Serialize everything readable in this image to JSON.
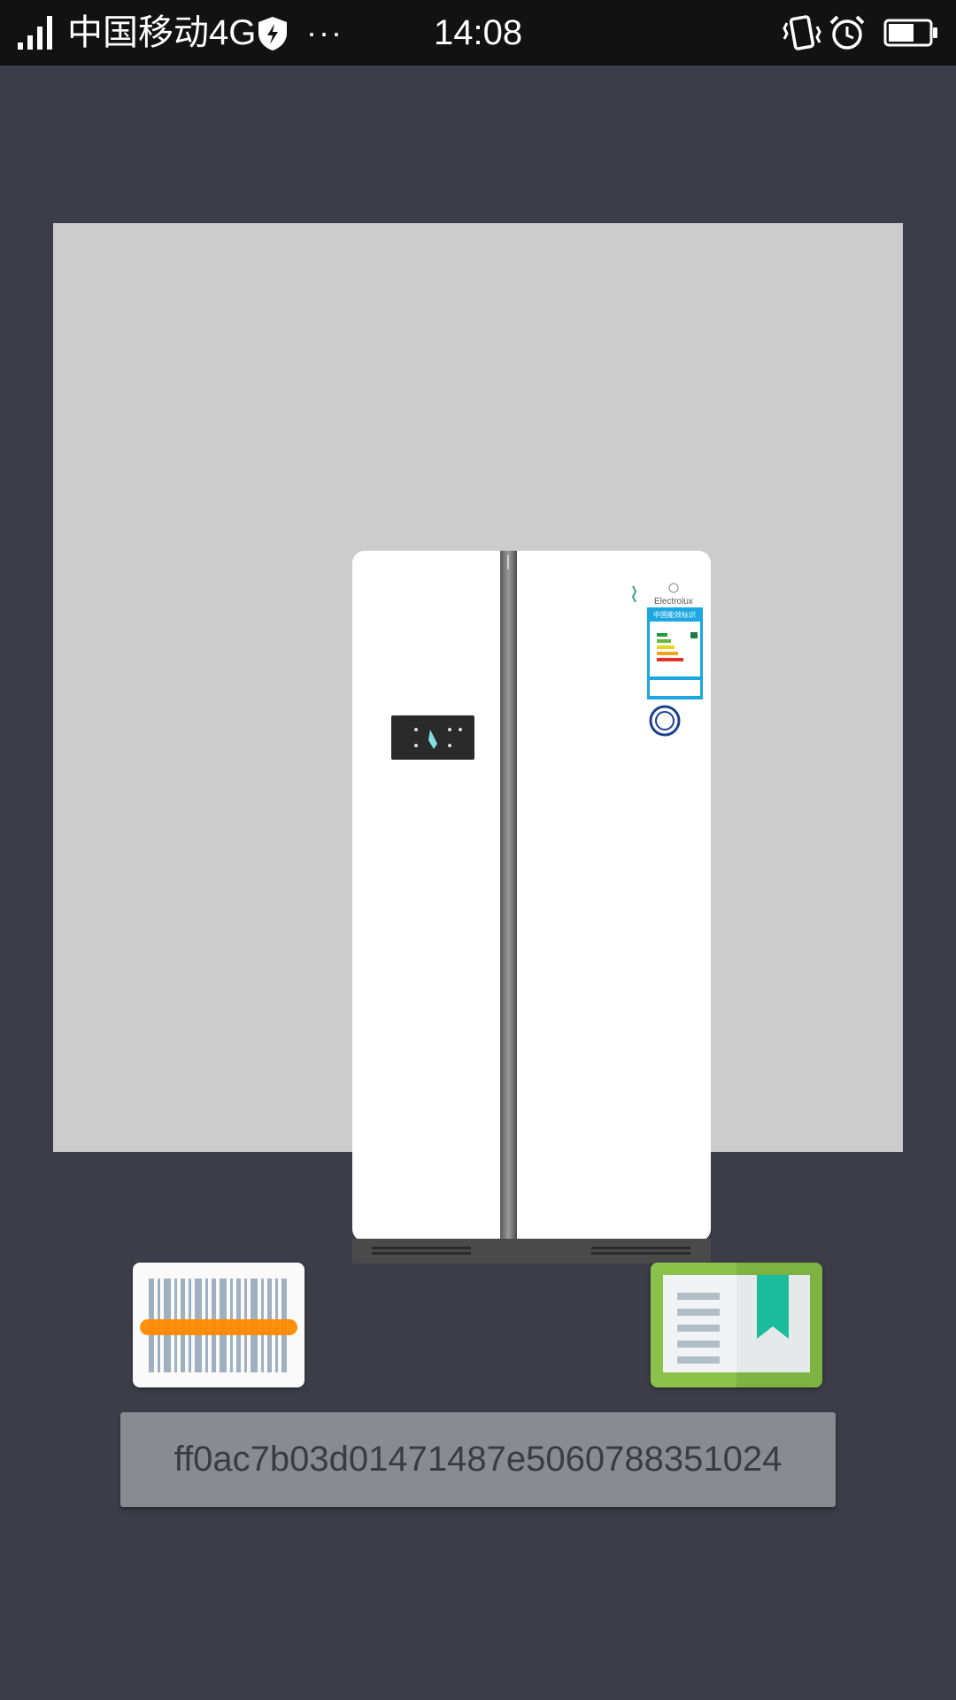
{
  "status_bar": {
    "carrier": "中国移动4G",
    "more": "···",
    "time": "14:08",
    "icons": [
      "signal-icon",
      "shield-icon",
      "vibrate-icon",
      "alarm-icon",
      "battery-icon"
    ],
    "background": "#121212"
  },
  "product": {
    "image": "refrigerator-image",
    "brand": "Electrolux",
    "energy_label_title": "中国能效标识",
    "panel_background": "#cccccc"
  },
  "actions": {
    "scan_icon": "barcode-scan-icon",
    "catalog_icon": "book-bookmark-icon",
    "scan_accent": "#ff8a00",
    "catalog_accent": "#8bc34a"
  },
  "id_field": {
    "value": "ff0ac7b03d01471487e5060788351024"
  },
  "colors": {
    "background": "#3d3d49",
    "field_background": "#8a8a92"
  }
}
